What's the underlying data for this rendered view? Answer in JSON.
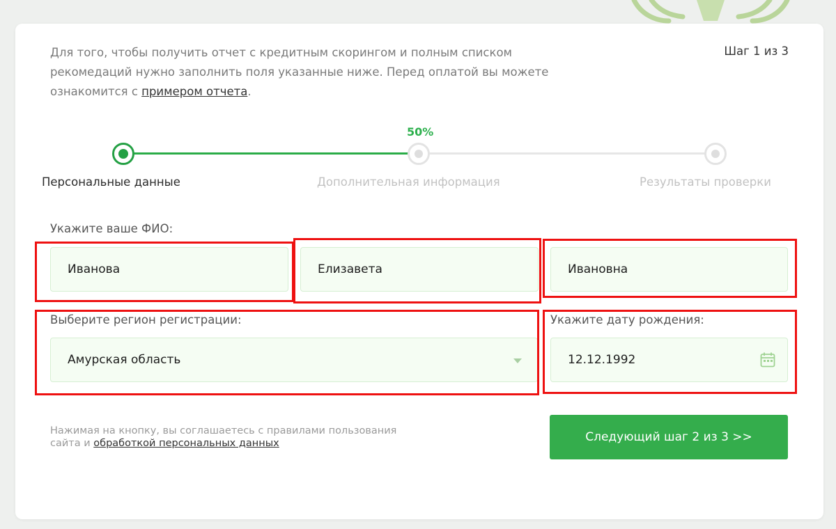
{
  "intro": {
    "text_before_link": "Для того, чтобы получить отчет с кредитным скорингом и полным списком рекомедаций нужно заполнить поля указанные ниже. Перед оплатой вы можете ознакомится с ",
    "link_text": "примером отчета",
    "text_after_link": "."
  },
  "step_counter": "Шаг 1 из 3",
  "progress": {
    "percent_label": "50%",
    "value": 0.5,
    "steps": [
      {
        "label": "Персональные данные",
        "state": "active"
      },
      {
        "label": "Дополнительная информация",
        "state": "inactive"
      },
      {
        "label": "Результаты проверки",
        "state": "inactive"
      }
    ]
  },
  "fio": {
    "label": "Укажите ваше ФИО:",
    "last_name": "Иванова",
    "first_name": "Елизавета",
    "middle_name": "Ивановна"
  },
  "region": {
    "label": "Выберите регион регистрации:",
    "selected": "Амурская область"
  },
  "birthdate": {
    "label": "Укажите дату рождения:",
    "value": "12.12.1992"
  },
  "consent": {
    "text": "Нажимая на кнопку, вы соглашаетесь с правилами пользования сайта и ",
    "link_text": "обработкой персональных данных"
  },
  "next_button": "Следующий шаг 2 из 3 >>",
  "colors": {
    "accent_green": "#34ad4c",
    "input_bg": "#f5fdf3",
    "highlight_red": "#ee1111"
  },
  "icons": {
    "date_picker": "calendar-icon",
    "select": "chevron-down-icon",
    "background": "emblem-logo"
  }
}
